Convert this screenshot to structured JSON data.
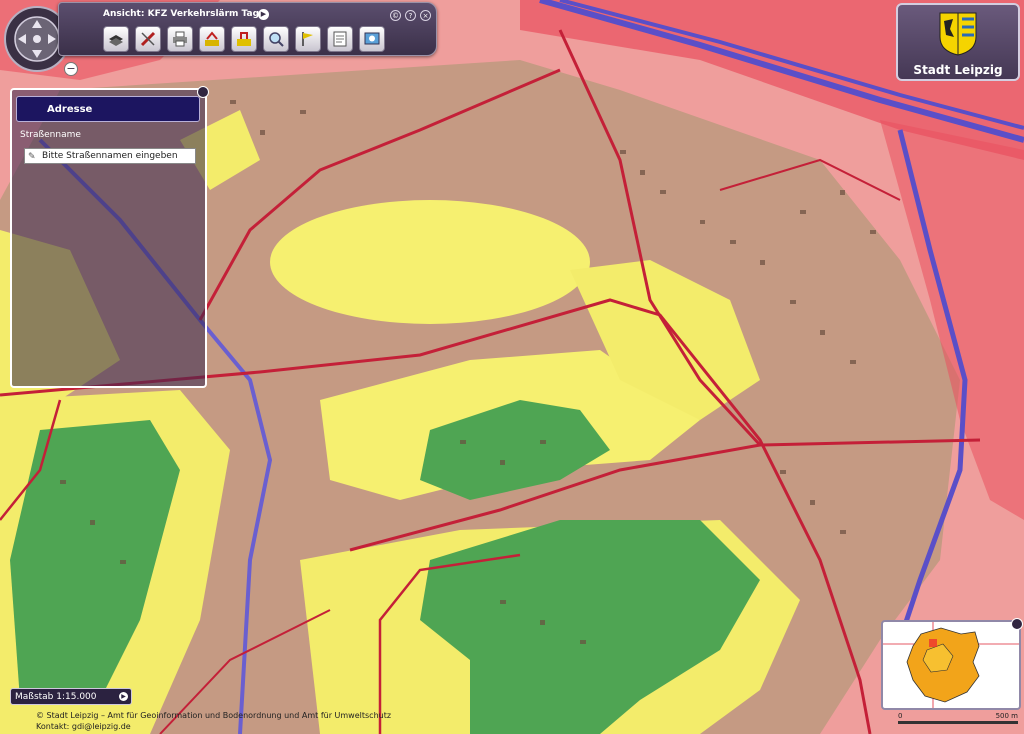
{
  "toolbar": {
    "view_title": "Ansicht: KFZ Verkehrslärm Tag",
    "buttons": [
      {
        "name": "layer-button",
        "icon": "layers-icon"
      },
      {
        "name": "measure-button",
        "icon": "ruler-icon"
      },
      {
        "name": "print-button",
        "icon": "printer-icon"
      },
      {
        "name": "legend-button",
        "icon": "legend-icon"
      },
      {
        "name": "select-button",
        "icon": "select-icon"
      },
      {
        "name": "search-button",
        "icon": "magnifier-icon"
      },
      {
        "name": "marker-button",
        "icon": "flag-icon"
      },
      {
        "name": "document-button",
        "icon": "document-icon"
      },
      {
        "name": "info-button",
        "icon": "info-icon"
      }
    ]
  },
  "address_panel": {
    "title": "Adresse",
    "street_label": "Straßenname",
    "street_placeholder": "Bitte Straßennamen eingeben"
  },
  "logo": {
    "text": "Stadt Leipzig"
  },
  "scale": {
    "label": "Maßstab 1:15.000"
  },
  "credits": {
    "line1": "© Stadt Leipzig – Amt für Geoinformation und Bodenordnung und Amt für Umweltschutz",
    "line2": "Kontakt: gdi@leipzig.de"
  },
  "scalebar": {
    "start": "0",
    "end": "500 m"
  },
  "colors": {
    "noise_very_high": "#e9505f",
    "noise_high": "#ef9aa0",
    "noise_mid_high": "#c09580",
    "noise_mid": "#f5f06a",
    "noise_low": "#4fa553",
    "motorway": "#5a4fc8",
    "road": "#c42038"
  }
}
